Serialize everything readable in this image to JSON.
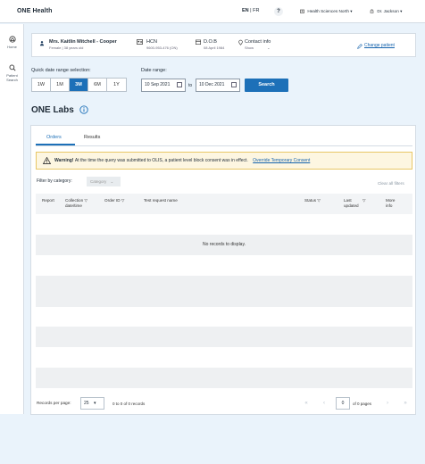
{
  "header": {
    "brand": "ONE Health",
    "lang_en": "EN",
    "lang_sep": "|",
    "lang_fr": "FR",
    "help": "?",
    "site": "Health Sciences North",
    "user": "Dr. Jackson"
  },
  "sidebar": {
    "home": "Home",
    "patient_search_1": "Patient",
    "patient_search_2": "Search"
  },
  "patient": {
    "name": "Mrs. Kaitlin Mitchell - Cooper",
    "sub": "Female | 38 years old",
    "hcn_label": "HCN",
    "hcn_value": "9600-953-476 (ON)",
    "dob_label": "D.O.B",
    "dob_value": "08 April 1984",
    "contact_label": "Contact info",
    "contact_value": "Show",
    "change": "Change patient"
  },
  "filters": {
    "quick_label": "Quick date range selection:",
    "range_label": "Date range:",
    "quick": [
      "1W",
      "1M",
      "3M",
      "6M",
      "1Y"
    ],
    "from": "10 Sep 2021",
    "to_word": "to",
    "to": "10 Dec 2021",
    "search": "Search"
  },
  "page": {
    "title": "ONE Labs"
  },
  "tabs": {
    "orders": "Orders",
    "results": "Results"
  },
  "warning": {
    "bold": "Warning!",
    "text": "At the time the query was submitted to OLIS, a patient level block consent was in effect.",
    "link": "Override Temporary Consent"
  },
  "table": {
    "filter_label": "Filter by category:",
    "category_placeholder": "Category",
    "clear": "Clear all filters",
    "headers": {
      "report": "Report",
      "collection1": "Collection",
      "collection2": "date/time",
      "order_id": "Order ID",
      "test": "Test request name",
      "status": "Status",
      "last1": "Last",
      "last2": "updated",
      "more1": "More",
      "more2": "info"
    },
    "empty": "No records to display."
  },
  "pagination": {
    "per_page_label": "Records per page:",
    "per_page": "25",
    "records": "0 to 0 of 0 records",
    "page": "0",
    "of_pages": "of 0 pages"
  },
  "colors": {
    "accent": "#1d70b8",
    "warning_bg": "#fdf6e1"
  }
}
